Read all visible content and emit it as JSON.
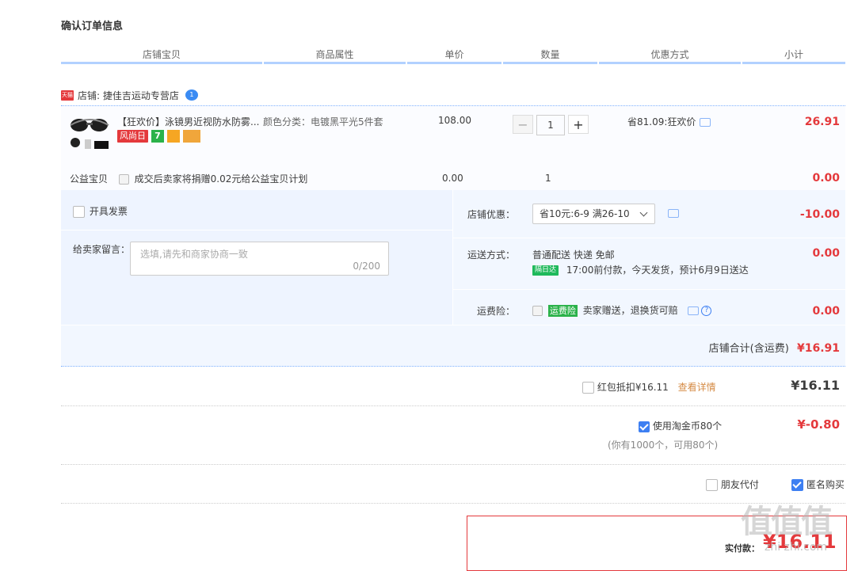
{
  "page_title": "确认订单信息",
  "columns": [
    "店铺宝贝",
    "商品属性",
    "单价",
    "数量",
    "优惠方式",
    "小计"
  ],
  "shop": {
    "badge": "天猫",
    "label": "店铺: 捷佳吉运动专营店"
  },
  "item": {
    "title": "【狂欢价】泳镜男近视防水防雾...",
    "sku": "颜色分类：电镀黑平光5件套",
    "badge_text": "风尚日",
    "badge_seven": "7",
    "price": "108.00",
    "quantity": "1",
    "minus": "−",
    "plus": "+",
    "promo": "省81.09:狂欢价",
    "subtotal": "26.91"
  },
  "charity": {
    "label": "公益宝贝",
    "desc": "成交后卖家将捐赠0.02元给公益宝贝计划",
    "price": "0.00",
    "quantity": "1",
    "subtotal": "0.00"
  },
  "invoice": {
    "label": "开具发票"
  },
  "message": {
    "label": "给卖家留言：",
    "placeholder": "选填,请先和商家协商一致",
    "counter": "0/200"
  },
  "shop_discount": {
    "label": "店铺优惠：",
    "selected": "省10元:6-9 满26-10",
    "amount": "-10.00"
  },
  "shipping": {
    "label": "运送方式：",
    "method": "普通配送 快递 免邮",
    "tag": "隔日达",
    "note": "17:00前付款，今天发货，预计6月9日送达",
    "amount": "0.00"
  },
  "insurance": {
    "label": "运费险：",
    "tag": "运费险",
    "desc": "卖家赠送，退换货可赔",
    "help": "?",
    "amount": "0.00"
  },
  "shop_total": {
    "label": "店铺合计(含运费)",
    "amount": "¥16.91"
  },
  "redpacket": {
    "label": "红包抵扣¥16.11",
    "link": "查看详情",
    "amount": "¥16.11"
  },
  "coins": {
    "label": "使用淘金币80个",
    "sub": "(你有1000个，可用80个)",
    "amount": "¥-0.80"
  },
  "friend_pay": {
    "label": "朋友代付"
  },
  "anonymous": {
    "label": "匿名购买"
  },
  "pay": {
    "label": "实付款：",
    "amount": "¥16.11"
  },
  "watermark": "值值值",
  "watermark_sub": "zhi zhi.com",
  "colors": {
    "accent_red": "#e4393c",
    "header_line": "#b2d1ff",
    "checkbox_blue": "#3d7ff2"
  }
}
